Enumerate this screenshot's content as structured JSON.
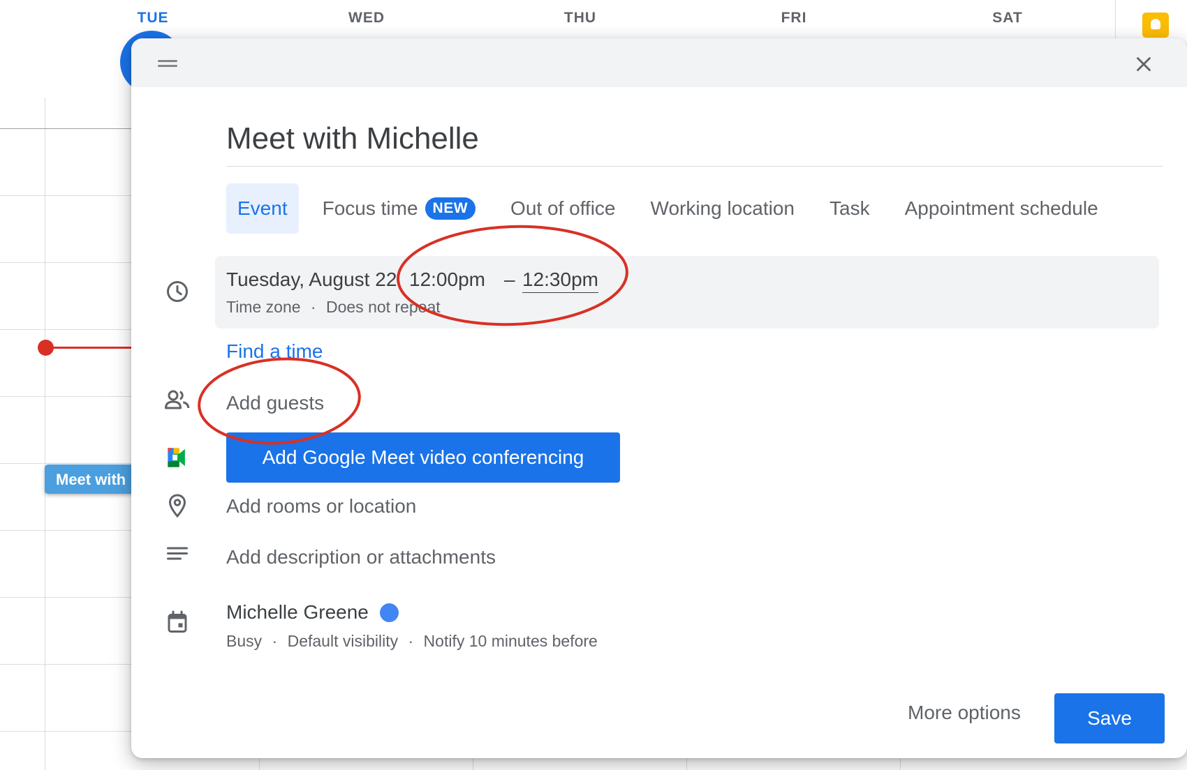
{
  "calendar": {
    "days": [
      "TUE",
      "WED",
      "THU",
      "FRI",
      "SAT"
    ],
    "background_event": "Meet with"
  },
  "dialog": {
    "title": "Meet with Michelle",
    "tabs": [
      {
        "label": "Event",
        "active": true
      },
      {
        "label": "Focus time",
        "badge": "NEW"
      },
      {
        "label": "Out of office"
      },
      {
        "label": "Working location"
      },
      {
        "label": "Task"
      },
      {
        "label": "Appointment schedule"
      }
    ],
    "datetime": {
      "date": "Tuesday, August 22",
      "start": "12:00pm",
      "separator": "–",
      "end": "12:30pm",
      "timezone": "Time zone",
      "dot": "·",
      "repeat": "Does not repeat"
    },
    "find_time": "Find a time",
    "guests_placeholder": "Add guests",
    "meet_button": "Add Google Meet video conferencing",
    "location_placeholder": "Add rooms or location",
    "description_placeholder": "Add description or attachments",
    "owner": {
      "name": "Michelle Greene",
      "dot_color": "#4285f4",
      "availability": "Busy",
      "visibility": "Default visibility",
      "notification": "Notify 10 minutes before"
    },
    "more_options": "More options",
    "save": "Save"
  },
  "colors": {
    "accent": "#1a73e8",
    "annotation_circle": "#d93025"
  }
}
